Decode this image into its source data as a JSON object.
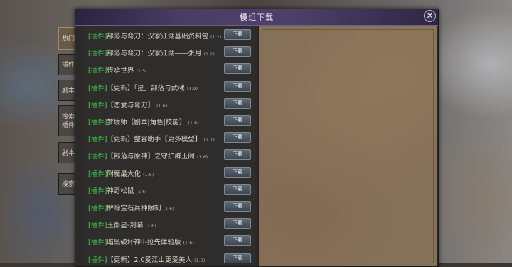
{
  "window": {
    "title": "模组下载",
    "close_glyph": "✕",
    "download_label": "下载"
  },
  "tabs": [
    {
      "label": "热门",
      "lines": [
        "热门"
      ]
    },
    {
      "label": "插件",
      "lines": [
        "插件"
      ]
    },
    {
      "label": "剧本",
      "lines": [
        "剧本"
      ]
    },
    {
      "label": "搜索插件",
      "lines": [
        "搜索",
        "插件"
      ]
    },
    {
      "label": "剧本",
      "lines": [
        "剧本"
      ]
    },
    {
      "label": "搜索",
      "lines": [
        "搜索"
      ]
    }
  ],
  "mods": [
    {
      "tag": "[插件]",
      "name": "部落与弯刀：汉家江湖基础资料包",
      "version": "(1.2)"
    },
    {
      "tag": "[插件]",
      "name": "部落与弯刀：汉家江湖——张月",
      "version": "(1.2)"
    },
    {
      "tag": "[插件]",
      "name": "传承世界",
      "version": "(1.5)"
    },
    {
      "tag": "[插件]",
      "name": "【更新】「星」部落与武魂",
      "version": "(1.9)"
    },
    {
      "tag": "[插件]",
      "name": "【恋爱与弯刀】",
      "version": "(1.6)"
    },
    {
      "tag": "[插件]",
      "name": "梦境师【剧本|角色|技能】",
      "version": "(1.6)"
    },
    {
      "tag": "[插件]",
      "name": "【更新】整容助手【更多模型】",
      "version": "(1.7)"
    },
    {
      "tag": "[插件]",
      "name": "【部落与原神】之守护群玉阁",
      "version": "(1.6)"
    },
    {
      "tag": "[插件]",
      "name": "附魔最大化",
      "version": "(1.6)"
    },
    {
      "tag": "[插件]",
      "name": "神奇松鼠",
      "version": "(1.6)"
    },
    {
      "tag": "[插件]",
      "name": "解除宝石兵种限制",
      "version": "(1.6)"
    },
    {
      "tag": "[插件]",
      "name": "玉衡星-刻晴",
      "version": "(1.6)"
    },
    {
      "tag": "[插件]",
      "name": "暗黑破坏神II-抢先体验版",
      "version": "(1.6)"
    },
    {
      "tag": "[插件]",
      "name": "【更新】2.0爱江山更爱美人",
      "version": "(1.9)"
    }
  ]
}
